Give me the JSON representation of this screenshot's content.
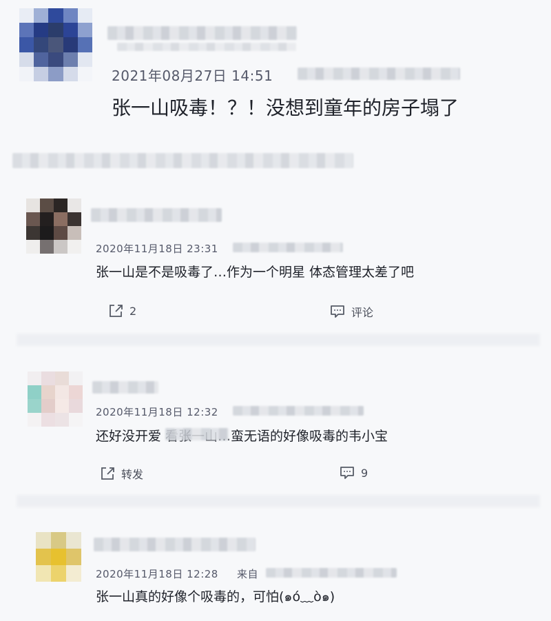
{
  "post": {
    "timestamp": "2021年08月27日 14:51",
    "text": "张一山吸毒！？！没想到童年的房子塌了"
  },
  "comments": [
    {
      "timestamp": "2020年11月18日 23:31",
      "text": "张一山是不是吸毒了…作为一个明星 体态管理太差了吧",
      "share_label": "2",
      "comment_label": "评论"
    },
    {
      "timestamp": "2020年11月18日 12:32",
      "text": "还好没开爱      看张一山…蛮无语的好像吸毒的韦小宝",
      "share_label": "转发",
      "comment_label": "9"
    },
    {
      "timestamp": "2020年11月18日 12:28",
      "source_prefix": "来自",
      "text": "张一山真的好像个吸毒的，可怕(๑ó﹏ò๑)"
    }
  ],
  "icons": {
    "share": "share-icon",
    "comment": "comment-icon"
  }
}
